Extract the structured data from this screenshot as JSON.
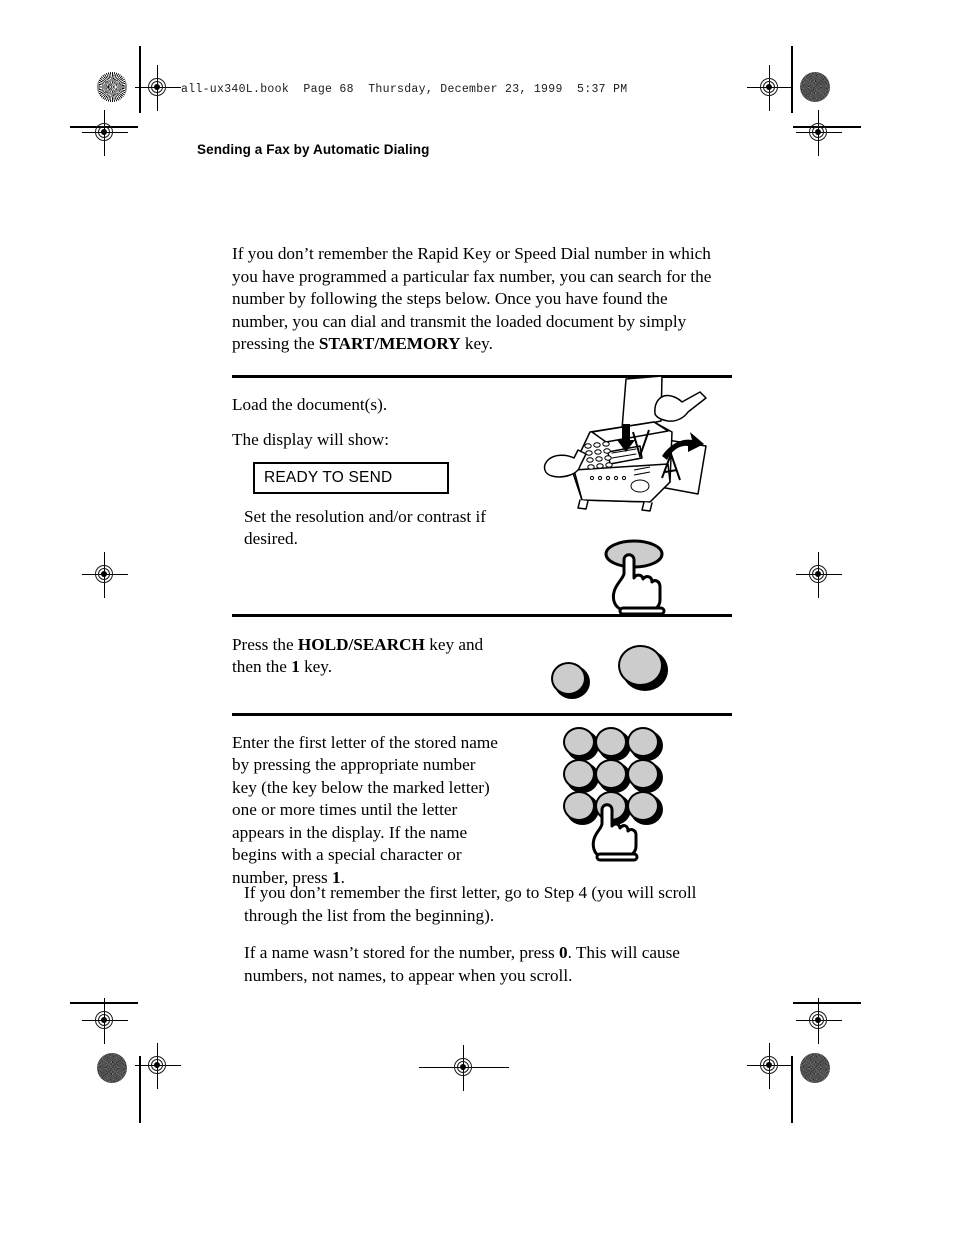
{
  "page": {
    "file_header": "all-ux340L.book  Page 68  Thursday, December 23, 1999  5:37 PM",
    "running_head": "Sending a Fax by Automatic Dialing"
  },
  "intro": {
    "text_before_bold": "If you don’t remember the Rapid Key or Speed Dial number in which you have programmed a particular fax number, you can search for the number by following the steps below. Once you have found the number, you can dial and transmit the loaded document by simply pressing the ",
    "bold_key": "START/MEMORY",
    "text_after_bold": " key."
  },
  "steps": [
    {
      "id": "step-load-document",
      "line1": "Load the document(s).",
      "line2": "The display will show:",
      "lcd_text": "READY TO SEND",
      "note": "Set the resolution and/or contrast if desired.",
      "illustration": "fax-machine-loading-document"
    },
    {
      "id": "step-hold-search",
      "text_before_bold": "Press the ",
      "bold_key": "HOLD/SEARCH",
      "text_middle": " key and then the ",
      "bold_key2": "1",
      "text_after": " key.",
      "illustration": "two-keys"
    },
    {
      "id": "step-enter-first-letter",
      "text_before_bold": "Enter the first letter of the stored name by pressing the appropriate number key (the key below the marked letter) one or more times until the letter appears in the display. If the name begins with a special character or number, press ",
      "bold_key": "1",
      "text_after_bold": ".",
      "illustration": "numeric-keypad"
    }
  ],
  "tail_notes": [
    {
      "id": "note-no-first-letter",
      "text": "If you don’t remember the first letter, go to Step 4 (you will scroll through the list from the beginning)."
    },
    {
      "id": "note-no-name-stored",
      "text_before_bold": "If a name wasn’t stored for the number, press ",
      "bold_key": "0",
      "text_after_bold": ". This will cause numbers, not names, to appear when you scroll."
    }
  ],
  "colors": {
    "key_fill": "#cccccc",
    "key_outline": "#000000",
    "rule": "#000000",
    "text": "#000000"
  },
  "marks": {
    "registration": "registration-crosshair",
    "halftone": "halftone-density-target"
  }
}
